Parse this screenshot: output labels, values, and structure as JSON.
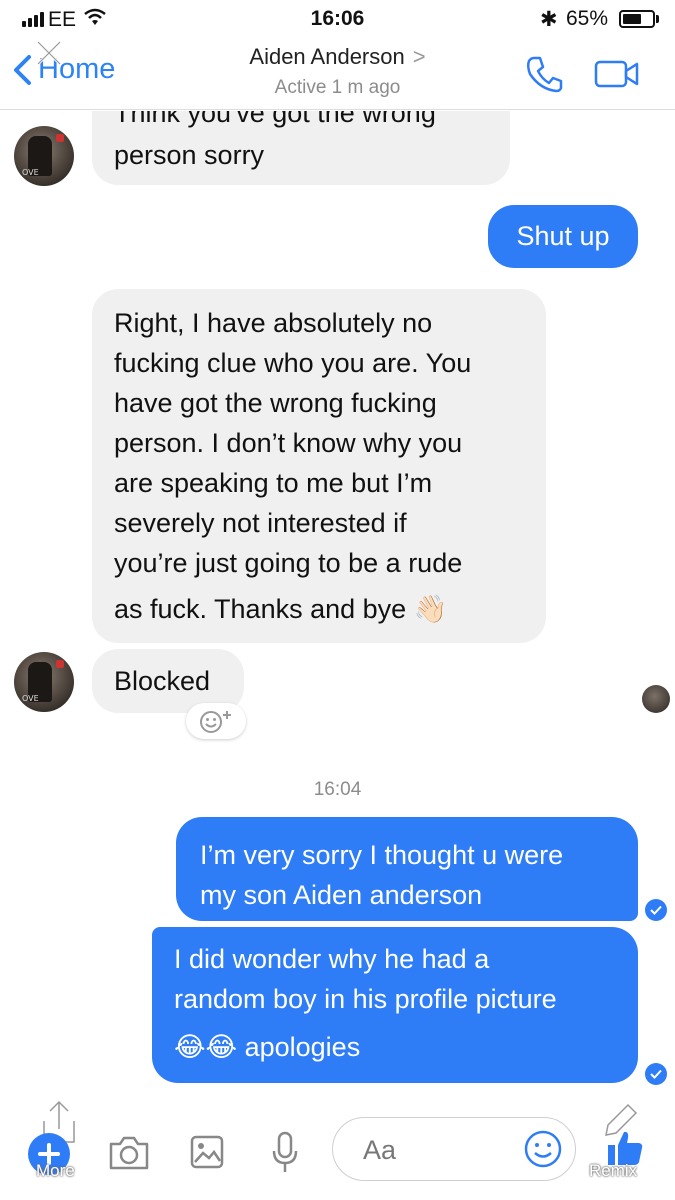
{
  "status_bar": {
    "carrier": "EE",
    "time": "16:06",
    "battery": "65%",
    "battery_level": 0.65
  },
  "header": {
    "back_label": "Home",
    "contact_name": "Aiden Anderson",
    "chevron": ">",
    "presence": "Active 1 m ago"
  },
  "messages": [
    {
      "from": "them",
      "text_lines": [
        "Think you've got the wrong",
        "person sorry"
      ]
    },
    {
      "from": "me",
      "text": "Shut up"
    },
    {
      "from": "them",
      "text_lines": [
        "Right, I have absolutely no",
        "fucking clue who you are. You",
        "have got the wrong fucking",
        "person. I don’t know why you",
        "are speaking to me but I’m",
        "severely not interested if",
        "you’re just going to be a rude",
        "as fuck. Thanks and bye 👋🏻"
      ]
    },
    {
      "from": "them",
      "text": "Blocked"
    },
    {
      "from": "me",
      "text_lines": [
        "I’m very sorry I thought u were",
        "my son Aiden anderson"
      ]
    },
    {
      "from": "me",
      "text_lines": [
        "I did wonder why he had a",
        "random boy in his profile picture",
        "😂😂 apologies"
      ]
    }
  ],
  "timestamp": "16:04",
  "composer": {
    "placeholder": "Aa",
    "more_label": "More",
    "remix_label": "Remix"
  },
  "colors": {
    "accent": "#2f7df6",
    "incoming_bubble": "#f1f0f0",
    "secondary_text": "#8c8c8c"
  },
  "icons": [
    "close-icon",
    "back-chevron-icon",
    "phone-icon",
    "video-icon",
    "camera-icon",
    "gallery-icon",
    "microphone-icon",
    "emoji-icon",
    "like-icon",
    "share-icon",
    "pen-icon",
    "add-reaction-icon",
    "delivered-check-icon"
  ]
}
